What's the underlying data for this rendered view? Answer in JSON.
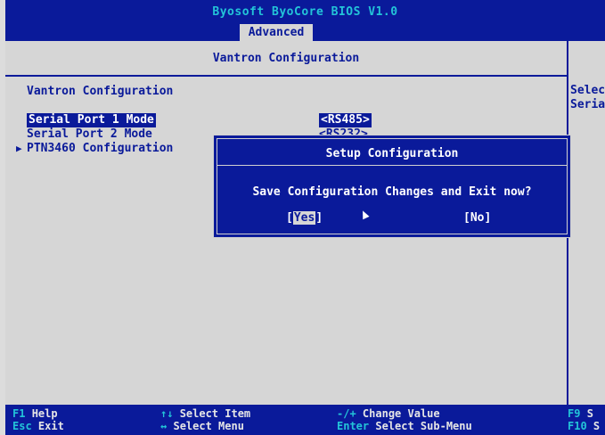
{
  "bios": {
    "title": "Byosoft ByoCore BIOS V1.0",
    "active_tab": "Advanced"
  },
  "panel": {
    "header": "Vantron Configuration",
    "section_title": "Vantron Configuration",
    "help_lines": [
      "Selec",
      "Seria"
    ],
    "items": [
      {
        "label": "Serial Port 1 Mode",
        "value": "<RS485>"
      },
      {
        "label": "Serial Port 2 Mode",
        "value": "<RS232>"
      },
      {
        "label": "PTN3460 Configuration",
        "submenu_marker": "▶"
      }
    ]
  },
  "dialog": {
    "title": "Setup Configuration",
    "question": "Save Configuration Changes and Exit now?",
    "yes": {
      "open": "[",
      "label": "Yes",
      "close": "]"
    },
    "no": "[No]"
  },
  "footer": {
    "row1": [
      {
        "key": "F1",
        "desc": "Help"
      },
      {
        "key": "↑↓",
        "desc": "Select Item"
      },
      {
        "key": "-/+",
        "desc": "Change Value"
      },
      {
        "key": "F9",
        "desc": "S"
      }
    ],
    "row2": [
      {
        "key": "Esc",
        "desc": "Exit"
      },
      {
        "key": "↔",
        "desc": "Select Menu"
      },
      {
        "key": "Enter",
        "desc": "Select Sub-Menu"
      },
      {
        "key": "F10",
        "desc": "S"
      }
    ]
  },
  "colors": {
    "bios_blue": "#0a1a9a",
    "panel_gray": "#d6d6d6",
    "key_cyan": "#23c4d8",
    "text_white": "#ffffff"
  }
}
